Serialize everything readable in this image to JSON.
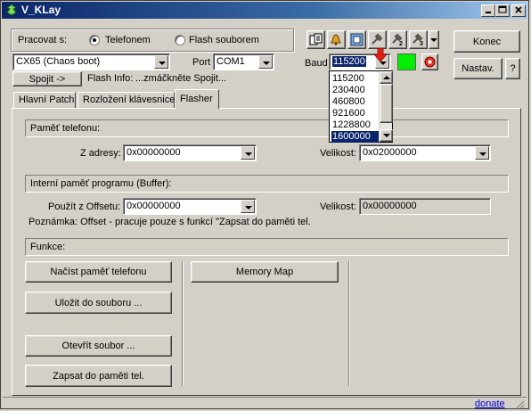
{
  "window": {
    "title": "V_KLay"
  },
  "mode": {
    "label": "Pracovat s:",
    "options": [
      "Telefonem",
      "Flash souborem"
    ],
    "selected": "Telefonem"
  },
  "model": {
    "value": "CX65 (Chaos boot)"
  },
  "port": {
    "label": "Port",
    "value": "COM1"
  },
  "baud": {
    "label": "Baud",
    "value": "115200",
    "options": [
      "115200",
      "230400",
      "460800",
      "921600",
      "1228800",
      "1600000"
    ],
    "highlighted": "1600000"
  },
  "status": {
    "connected_color": "#00ee00"
  },
  "connect": {
    "button_label": "Spojit ->",
    "info_label": "Flash Info:",
    "info_text": "...zmáčkněte Spojit..."
  },
  "buttons": {
    "konec": "Konec",
    "nastav": "Nastav.",
    "help": "?"
  },
  "toolbar_icons": [
    "memory-icon",
    "bell-icon",
    "chip-icon",
    "tool-1-icon",
    "tool-2-icon",
    "tool-3-icon",
    "dropdown-icon"
  ],
  "tabs": [
    "Hlavní Patch",
    "Rozložení klávesnice",
    "Flasher"
  ],
  "active_tab": "Flasher",
  "phone_memory": {
    "header": "Paměť telefonu:",
    "from_label": "Z adresy:",
    "from_value": "0x00000000",
    "size_label": "Velikost:",
    "size_value": "0x02000000"
  },
  "buffer": {
    "header": "Interní paměť programu (Buffer):",
    "offset_label": "Použít z Offsetu:",
    "offset_value": "0x00000000",
    "size_label": "Velikost:",
    "size_value": "0x00000000",
    "note": "Poznámka: Offset - pracuje pouze s funkcí \"Zapsat do paměti tel."
  },
  "functions": {
    "header": "Funkce:",
    "read": "Načíst paměť telefonu",
    "save": "Uložit do souboru ...",
    "open": "Otevřít soubor ...",
    "write": "Zapsat do paměti tel.",
    "map": "Memory Map"
  },
  "footer": {
    "donate": "donate"
  }
}
